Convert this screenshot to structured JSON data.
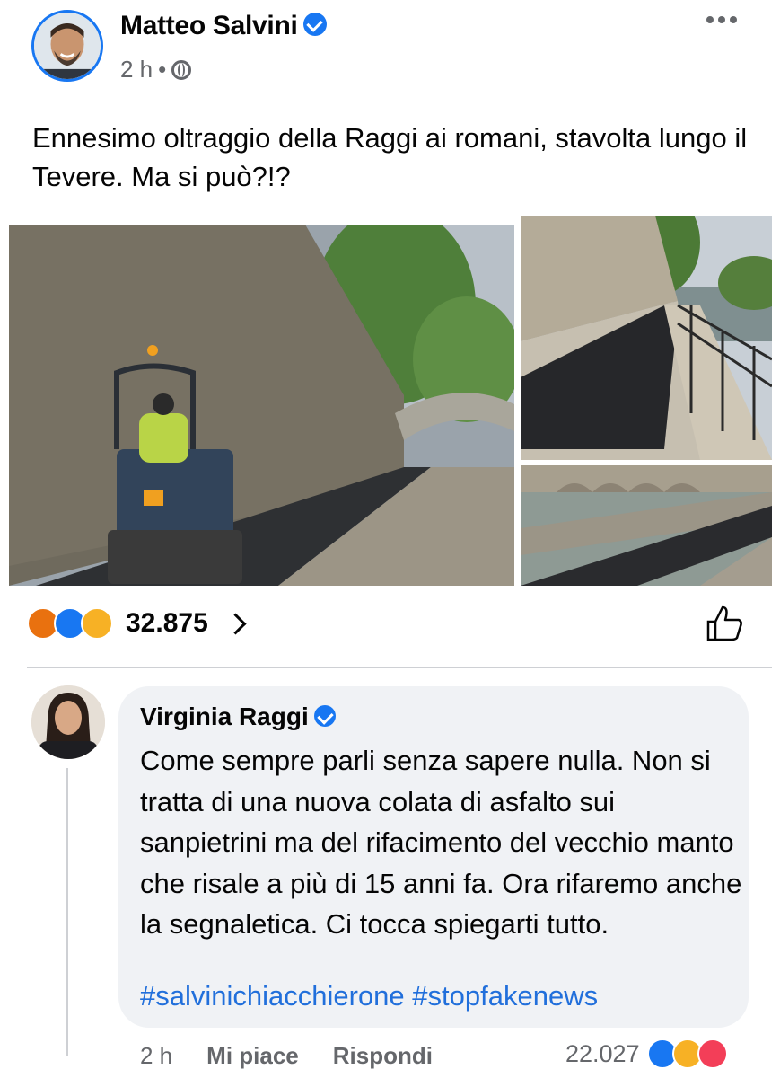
{
  "post": {
    "author": "Matteo Salvini",
    "time": "2 h",
    "separator": "•",
    "text": "Ennesimo oltraggio della Raggi ai romani, stavolta lungo il Tevere. Ma si può?!?",
    "reactions_count": "32.875"
  },
  "comment": {
    "author": "Virginia Raggi",
    "text": "Come sempre parli senza sapere nulla. Non si tratta di una nuova colata di asfalto sui sanpietrini ma del rifacimento del vecchio manto che risale a più di 15 anni fa. Ora rifaremo anche la segnaletica. Ci tocca spiegarti tutto.",
    "hashtags": "#salvinichiacchierone #stopfakenews",
    "time": "2 h",
    "like_label": "Mi piace",
    "reply_label": "Rispondi",
    "reactions_count": "22.027"
  },
  "colors": {
    "accent": "#1877f2",
    "hashtag": "#216fdb",
    "secondary_text": "#65676b",
    "bubble": "#f0f2f5"
  },
  "icons": [
    "verified-icon",
    "globe-icon",
    "more-icon",
    "angry-reaction-icon",
    "like-reaction-icon",
    "wow-reaction-icon",
    "chevron-right-icon",
    "thumbs-up-icon",
    "haha-reaction-icon",
    "love-reaction-icon"
  ]
}
